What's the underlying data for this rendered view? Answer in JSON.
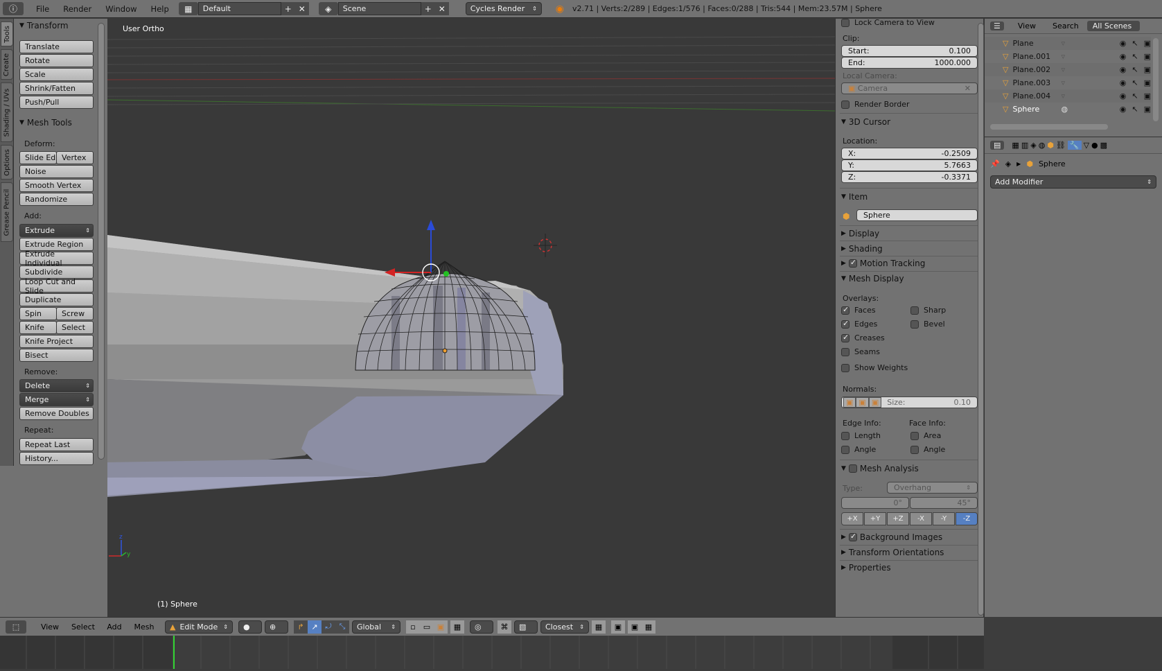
{
  "topbar": {
    "menus": [
      "File",
      "Render",
      "Window",
      "Help"
    ],
    "layout_screen": "Default",
    "scene": "Scene",
    "render_engine": "Cycles Render",
    "info": "v2.71 | Verts:2/289 | Edges:1/576 | Faces:0/288 | Tris:544 | Mem:23.57M | Sphere"
  },
  "side_tabs": [
    "Tools",
    "Create",
    "Shading / UVs",
    "Options",
    "Grease Pencil"
  ],
  "toolshelf": {
    "transform_header": "Transform",
    "transform": [
      "Translate",
      "Rotate",
      "Scale",
      "Shrink/Fatten",
      "Push/Pull"
    ],
    "mesh_tools_header": "Mesh Tools",
    "deform_label": "Deform:",
    "slide_edge": "Slide Ed",
    "vertex": "Vertex",
    "noise": "Noise",
    "smooth_vertex": "Smooth Vertex",
    "randomize": "Randomize",
    "add_label": "Add:",
    "extrude": "Extrude",
    "extrude_region": "Extrude Region",
    "extrude_individual": "Extrude Individual",
    "subdivide": "Subdivide",
    "loop_cut": "Loop Cut and Slide",
    "duplicate": "Duplicate",
    "spin": "Spin",
    "screw": "Screw",
    "knife": "Knife",
    "select": "Select",
    "knife_project": "Knife Project",
    "bisect": "Bisect",
    "remove_label": "Remove:",
    "delete": "Delete",
    "merge": "Merge",
    "remove_doubles": "Remove Doubles",
    "repeat_label": "Repeat:",
    "repeat_last": "Repeat Last",
    "history": "History..."
  },
  "viewport": {
    "view_name": "User Ortho",
    "active_object_label": "(1) Sphere"
  },
  "properties": {
    "lock_camera": "Lock Camera to View",
    "clip_label": "Clip:",
    "clip_start_label": "Start:",
    "clip_start": "0.100",
    "clip_end_label": "End:",
    "clip_end": "1000.000",
    "local_camera_label": "Local Camera:",
    "camera": "Camera",
    "render_border": "Render Border",
    "cursor_header": "3D Cursor",
    "location_label": "Location:",
    "x_label": "X:",
    "x": "-0.2509",
    "y_label": "Y:",
    "y": "5.7663",
    "z_label": "Z:",
    "z": "-0.3371",
    "item_header": "Item",
    "item_name": "Sphere",
    "display": "Display",
    "shading": "Shading",
    "motion_tracking": "Motion Tracking",
    "mesh_display": "Mesh Display",
    "overlays_label": "Overlays:",
    "faces": "Faces",
    "sharp": "Sharp",
    "edges": "Edges",
    "bevel": "Bevel",
    "creases": "Creases",
    "seams": "Seams",
    "show_weights": "Show Weights",
    "normals_label": "Normals:",
    "size_label": "Size:",
    "size": "0.10",
    "edge_info": "Edge Info:",
    "face_info": "Face Info:",
    "length": "Length",
    "area": "Area",
    "angle": "Angle",
    "mesh_analysis": "Mesh Analysis",
    "type_label": "Type:",
    "type": "Overhang",
    "range_min": "0°",
    "range_max": "45°",
    "axes": [
      "+X",
      "+Y",
      "+Z",
      "-X",
      "-Y",
      "-Z"
    ],
    "background_images": "Background Images",
    "transform_orientations": "Transform Orientations",
    "properties": "Properties"
  },
  "outliner": {
    "view": "View",
    "search": "Search",
    "scenes": "All Scenes",
    "items": [
      "Plane",
      "Plane.001",
      "Plane.002",
      "Plane.003",
      "Plane.004",
      "Sphere"
    ]
  },
  "modifiers": {
    "object": "Sphere",
    "add_modifier": "Add Modifier"
  },
  "header3d": {
    "view": "View",
    "select": "Select",
    "add": "Add",
    "mesh": "Mesh",
    "mode": "Edit Mode",
    "orientation": "Global",
    "snap": "Closest"
  },
  "colors": {
    "accent_blue": "#5680c2",
    "panel": "#727272",
    "viewport_bg": "#393939"
  }
}
